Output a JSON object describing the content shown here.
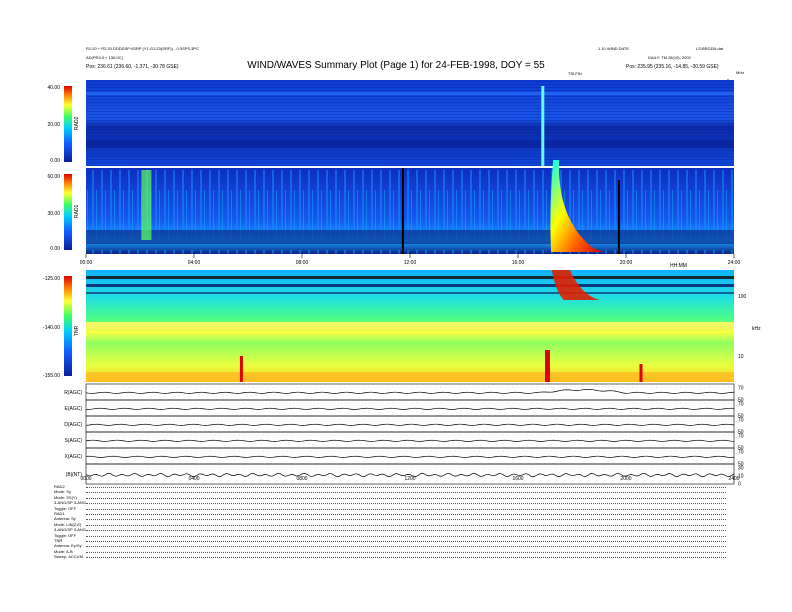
{
  "header": {
    "title": "WIND/WAVES Summary Plot (Page 1) for 24-FEB-1998, DOY = 55",
    "left_line1": "R1:20 + R2:20 DDDDSP:4SRP (Y1:G1:Z0(SRF)) - 0:3SPS:3PC",
    "left_line2": "AD(PR3:3 + 130:0C)",
    "left_line3_label": "Pos:",
    "left_line3_value": "236.61 (236.60, -1.371, -30.78 GSE)",
    "right_line1": "1.10 WIND DATE",
    "right_line2": "LS:BRGDN.dat",
    "right_line3": "DAILY: TM 28(19), 2002",
    "right_line4_label": "Pos:",
    "right_line4_value": "235.95 (235.16, -14.85, -30.59 GSE)",
    "center_small": "TSLFIN",
    "right_small_u": "u",
    "right_small_mhz": "MHz"
  },
  "chart_data": [
    {
      "type": "heatmap",
      "panel": "RAD2",
      "ylabel": "RAD2",
      "colorbar_ticks": [
        "40.00",
        "20.00",
        "0.00"
      ],
      "colorbar_range": [
        0,
        40
      ],
      "xlim_hours": [
        0,
        24
      ],
      "events": [
        {
          "t_hours": 16.9,
          "kind": "narrowband line"
        }
      ]
    },
    {
      "type": "heatmap",
      "panel": "RAD1",
      "ylabel": "RAD1",
      "colorbar_ticks": [
        "60.00",
        "30.00",
        "0.00"
      ],
      "colorbar_range": [
        0,
        60
      ],
      "xlim_hours": [
        0,
        24
      ],
      "x_ticks": [
        "00:00",
        "04:00",
        "08:00",
        "12:00",
        "16:00",
        "20:00",
        "24:00"
      ],
      "events": [
        {
          "t_hours": 2.2,
          "kind": "type III burst"
        },
        {
          "t_hours": 17.3,
          "kind": "type III burst (strong)"
        }
      ]
    },
    {
      "type": "heatmap",
      "panel": "TNR",
      "ylabel": "TNR",
      "colorbar_ticks": [
        "-125.00",
        "-140.00",
        "-155.00"
      ],
      "colorbar_range": [
        -155,
        -125
      ],
      "right_axis_ticks": [
        "100",
        "10"
      ],
      "right_axis_label": "kHz",
      "x_ticks_label": "HH:MM",
      "xlim_hours": [
        0,
        24
      ]
    },
    {
      "type": "line",
      "panel": "AGC",
      "rows": [
        {
          "label": "R(AGC)",
          "right_ticks": [
            "70",
            "50"
          ]
        },
        {
          "label": "E(AGC)",
          "right_ticks": [
            "70",
            "50"
          ]
        },
        {
          "label": "D(AGC)",
          "right_ticks": [
            "70",
            "50"
          ]
        },
        {
          "label": "S(AGC)",
          "right_ticks": [
            "70",
            "50"
          ]
        },
        {
          "label": "X(AGC)",
          "right_ticks": [
            "70",
            "50"
          ]
        },
        {
          "label": "|B|(NT)",
          "right_ticks": [
            "30",
            "10",
            "0"
          ]
        }
      ],
      "x_ticks": [
        "0000",
        "0400",
        "0800",
        "1200",
        "1600",
        "2000",
        "2400"
      ],
      "xlim_hours": [
        0,
        24
      ]
    }
  ],
  "footer": {
    "lines": [
      "RAD2",
      "Mode:      Sy",
      "Mode:   SS(Y)",
      "3-ANG/SP 3-ANG",
      "Toggle:    OFF",
      "RAD1",
      "Antenna:    Sy",
      "Mode:  LIN(Z,E)",
      "3-ANG/SP 3-ANG",
      "Toggle:    OFF",
      "TNR",
      "Antenna:  Ey/Sy",
      "Mode:     A-B",
      "Sweep:  ACCUM."
    ]
  },
  "colors": {
    "background": "#ffffff",
    "deep_blue": "#0a1e9c",
    "blue": "#1040ff",
    "cyan": "#00c8ff",
    "green": "#40ff60",
    "yellow": "#ffff30",
    "orange": "#ff8000",
    "red": "#e00000"
  }
}
